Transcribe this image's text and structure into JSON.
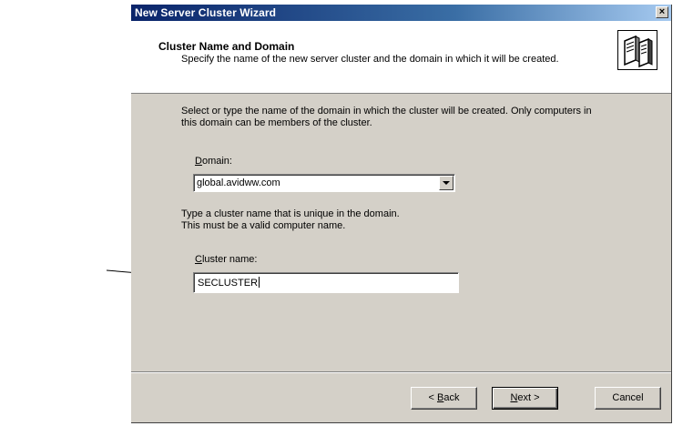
{
  "window": {
    "title": "New Server Cluster Wizard",
    "close_glyph": "×"
  },
  "header": {
    "title": "Cluster Name and Domain",
    "subtitle": "Specify the name of the new server cluster and the domain in which it will be created.",
    "icon": "server-cluster-icon"
  },
  "body": {
    "domain_intro": "Select or type the name of the domain in which the cluster will be created. Only computers in this domain can be members of the cluster.",
    "domain_label_accel": "D",
    "domain_label_rest": "omain:",
    "domain_value": "global.avidww.com",
    "cluster_intro_line1": "Type a cluster name that is unique in the domain.",
    "cluster_intro_line2": "This must be a valid computer name.",
    "cluster_label_accel": "C",
    "cluster_label_rest": "luster name:",
    "cluster_value": "SECLUSTER"
  },
  "buttons": {
    "back_prefix": "< ",
    "back_accel": "B",
    "back_rest": "ack",
    "next_accel": "N",
    "next_rest": "ext >",
    "cancel": "Cancel"
  },
  "colors": {
    "titlebar": "#0a246a",
    "dialog_face": "#d4d0c8",
    "header_bg": "#ffffff"
  }
}
